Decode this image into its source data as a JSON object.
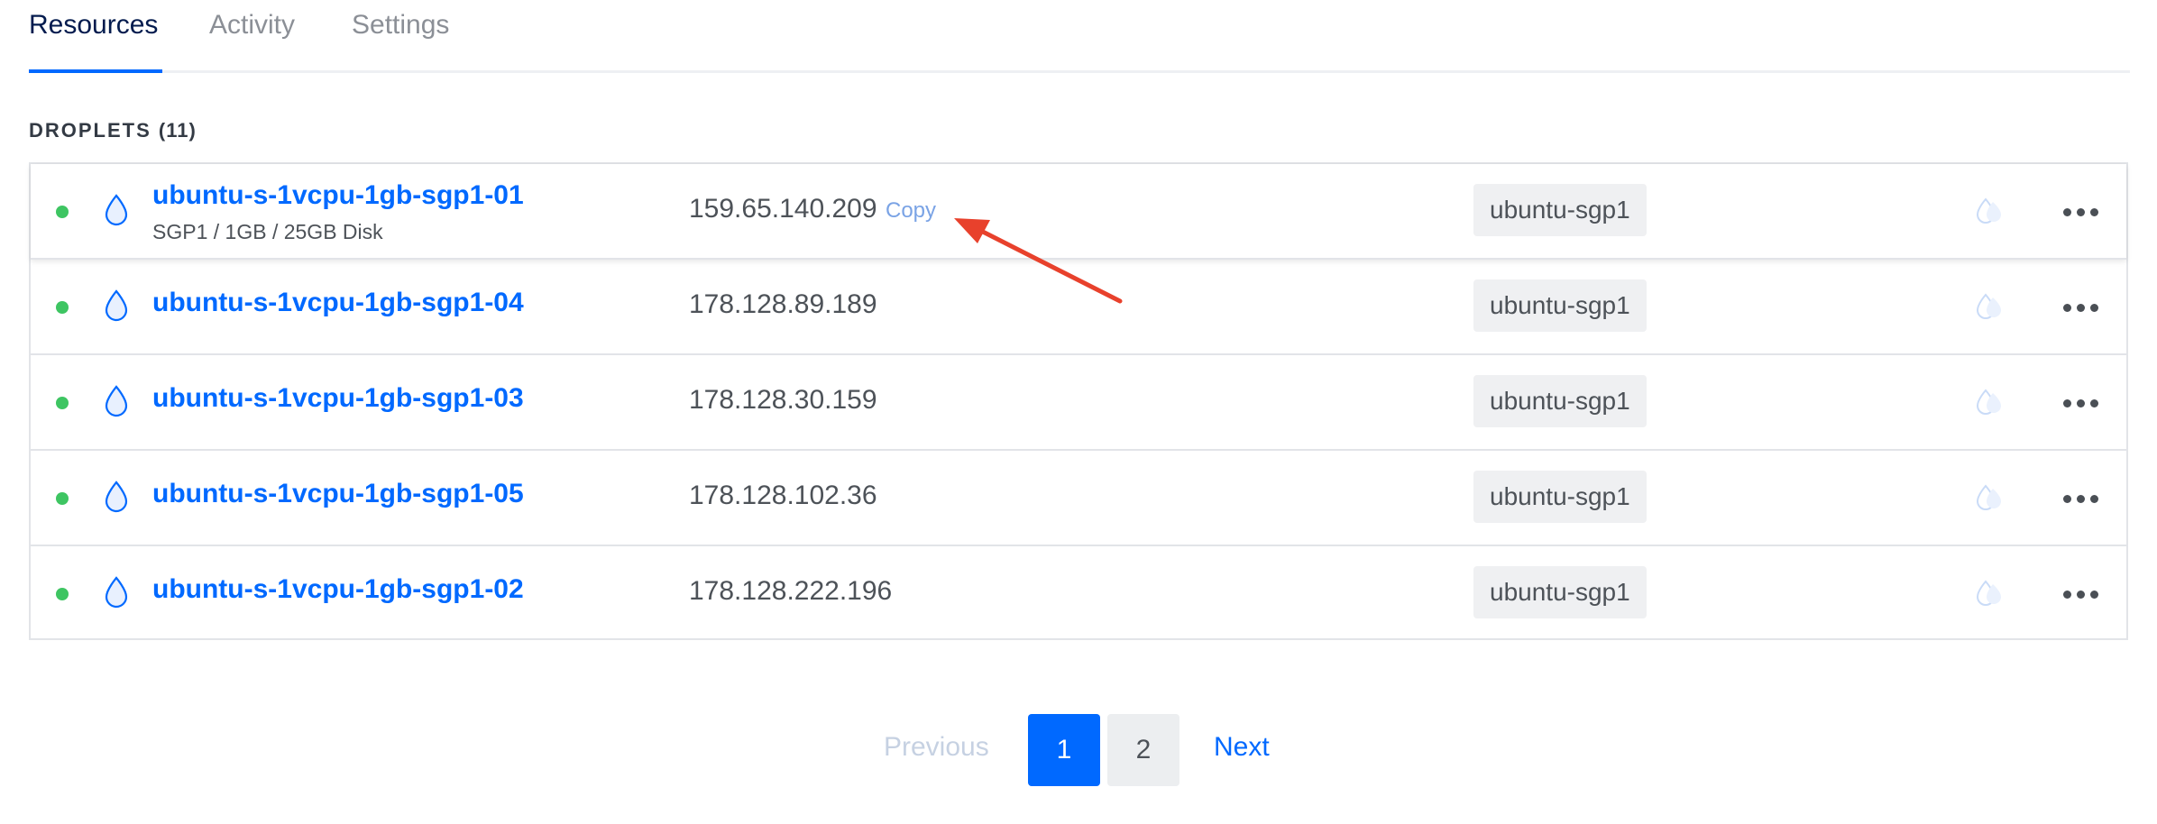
{
  "tabs": [
    {
      "label": "Resources",
      "active": true
    },
    {
      "label": "Activity",
      "active": false
    },
    {
      "label": "Settings",
      "active": false
    }
  ],
  "section": {
    "title": "DROPLETS",
    "count": "(11)"
  },
  "droplets": [
    {
      "name": "ubuntu-s-1vcpu-1gb-sgp1-01",
      "meta": "SGP1 / 1GB / 25GB Disk",
      "ip": "159.65.140.209",
      "copy_label": "Copy",
      "tag": "ubuntu-sgp1",
      "status": "active"
    },
    {
      "name": "ubuntu-s-1vcpu-1gb-sgp1-04",
      "ip": "178.128.89.189",
      "tag": "ubuntu-sgp1",
      "status": "active"
    },
    {
      "name": "ubuntu-s-1vcpu-1gb-sgp1-03",
      "ip": "178.128.30.159",
      "tag": "ubuntu-sgp1",
      "status": "active"
    },
    {
      "name": "ubuntu-s-1vcpu-1gb-sgp1-05",
      "ip": "178.128.102.36",
      "tag": "ubuntu-sgp1",
      "status": "active"
    },
    {
      "name": "ubuntu-s-1vcpu-1gb-sgp1-02",
      "ip": "178.128.222.196",
      "tag": "ubuntu-sgp1",
      "status": "active"
    }
  ],
  "pagination": {
    "previous": "Previous",
    "pages": [
      "1",
      "2"
    ],
    "current": "1",
    "next": "Next"
  },
  "colors": {
    "accent": "#0069ff",
    "status_active": "#3ec562",
    "annotation_arrow": "#e8412c"
  },
  "icons": {
    "droplet": "droplet-icon",
    "more": "more-horizontal-icon"
  }
}
